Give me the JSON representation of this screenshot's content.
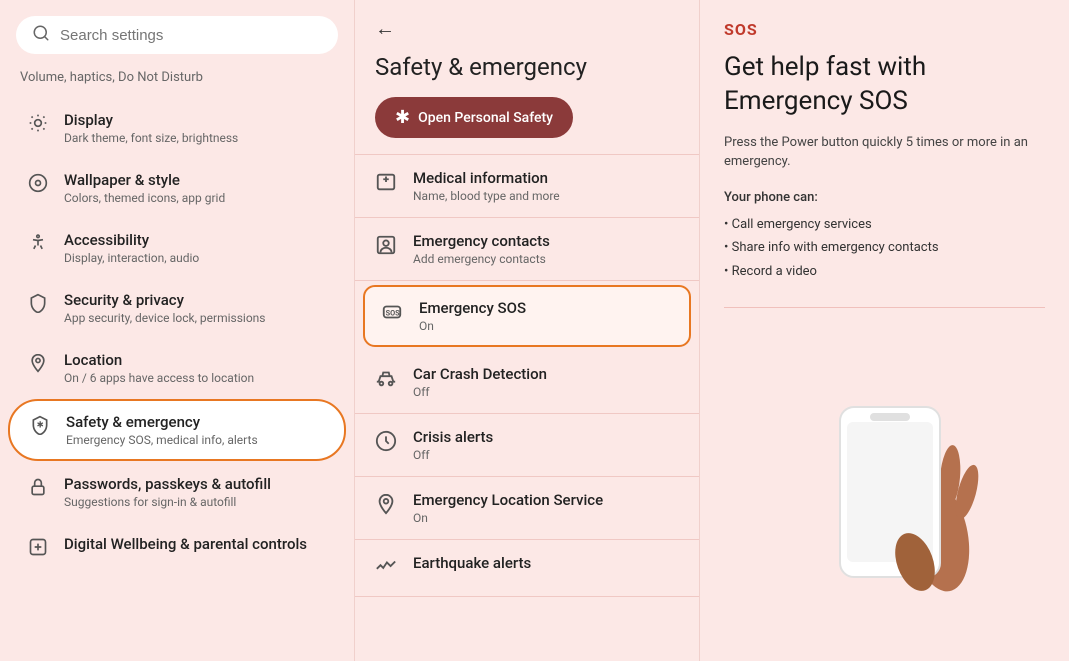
{
  "search": {
    "placeholder": "Search settings"
  },
  "volume_hint": "Volume, haptics, Do Not Disturb",
  "nav_items": [
    {
      "id": "display",
      "title": "Display",
      "subtitle": "Dark theme, font size, brightness",
      "icon": "display-icon"
    },
    {
      "id": "wallpaper",
      "title": "Wallpaper & style",
      "subtitle": "Colors, themed icons, app grid",
      "icon": "wallpaper-icon"
    },
    {
      "id": "accessibility",
      "title": "Accessibility",
      "subtitle": "Display, interaction, audio",
      "icon": "accessibility-icon"
    },
    {
      "id": "security",
      "title": "Security & privacy",
      "subtitle": "App security, device lock, permissions",
      "icon": "security-icon"
    },
    {
      "id": "location",
      "title": "Location",
      "subtitle": "On / 6 apps have access to location",
      "icon": "location-icon"
    },
    {
      "id": "safety",
      "title": "Safety & emergency",
      "subtitle": "Emergency SOS, medical info, alerts",
      "icon": "safety-icon",
      "active": true
    },
    {
      "id": "passwords",
      "title": "Passwords, passkeys & autofill",
      "subtitle": "Suggestions for sign-in & autofill",
      "icon": "passwords-icon"
    },
    {
      "id": "wellbeing",
      "title": "Digital Wellbeing & parental controls",
      "subtitle": "",
      "icon": "wellbeing-icon"
    }
  ],
  "middle_panel": {
    "back_label": "←",
    "title": "Safety & emergency",
    "open_btn_label": "Open Personal Safety",
    "menu_items": [
      {
        "id": "medical",
        "title": "Medical information",
        "subtitle": "Name, blood type and more",
        "icon": "medical-icon"
      },
      {
        "id": "emergency-contacts",
        "title": "Emergency contacts",
        "subtitle": "Add emergency contacts",
        "icon": "contacts-icon"
      },
      {
        "id": "emergency-sos",
        "title": "Emergency SOS",
        "subtitle": "On",
        "icon": "sos-icon",
        "active": true
      },
      {
        "id": "car-crash",
        "title": "Car Crash Detection",
        "subtitle": "Off",
        "icon": "car-crash-icon"
      },
      {
        "id": "crisis-alerts",
        "title": "Crisis alerts",
        "subtitle": "Off",
        "icon": "crisis-icon"
      },
      {
        "id": "emergency-location",
        "title": "Emergency Location Service",
        "subtitle": "On",
        "icon": "location-service-icon"
      },
      {
        "id": "earthquake",
        "title": "Earthquake alerts",
        "subtitle": "",
        "icon": "earthquake-icon"
      }
    ]
  },
  "right_panel": {
    "sos_label": "SOS",
    "main_title": "Get help fast with Emergency SOS",
    "description": "Press the Power button quickly 5 times or more in an emergency.",
    "phone_can_label": "Your phone can:",
    "capabilities": [
      "Call emergency services",
      "Share info with emergency contacts",
      "Record a video"
    ]
  }
}
